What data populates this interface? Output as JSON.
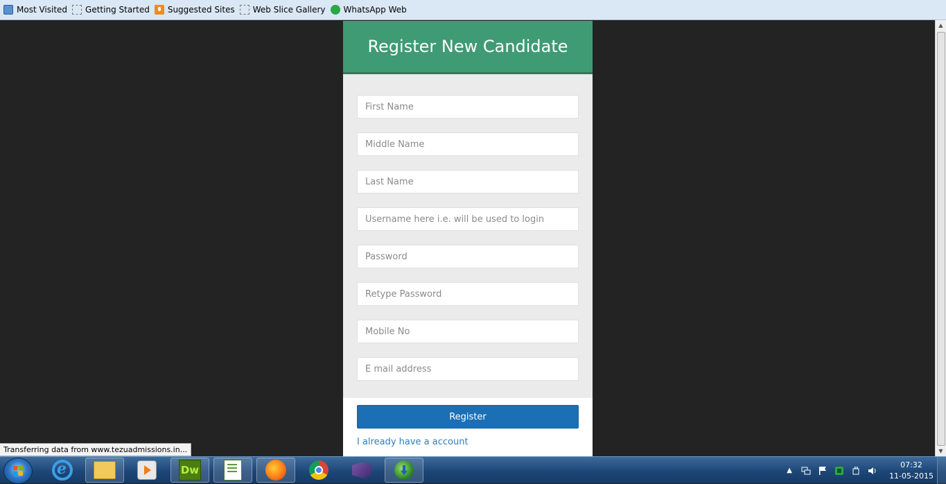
{
  "bookmarks": [
    {
      "label": "Most Visited",
      "icon": "most-visited-icon"
    },
    {
      "label": "Getting Started",
      "icon": "page-icon"
    },
    {
      "label": "Suggested Sites",
      "icon": "suggested-sites-icon"
    },
    {
      "label": "Web Slice Gallery",
      "icon": "page-icon"
    },
    {
      "label": "WhatsApp Web",
      "icon": "whatsapp-icon"
    }
  ],
  "form": {
    "title": "Register New Candidate",
    "fields": {
      "first_name": "First Name",
      "middle_name": "Middle Name",
      "last_name": "Last Name",
      "username": "Username here i.e. will be used to login",
      "password": "Password",
      "retype_password": "Retype Password",
      "mobile": "Mobile No",
      "email": "E mail address"
    },
    "register_label": "Register",
    "login_link": "I already have a account",
    "colors": {
      "header": "#3f9b73",
      "button": "#1a6fb5",
      "link": "#2f7dc0"
    }
  },
  "status_bar": "Transferring data from www.tezuadmissions.in...",
  "taskbar": {
    "apps": [
      "internet-explorer",
      "windows-explorer",
      "media-player",
      "dreamweaver",
      "notepad-plus-plus",
      "firefox",
      "chrome",
      "visual-studio",
      "internet-download-manager"
    ],
    "time": "07:32",
    "date": "11-05-2015"
  }
}
